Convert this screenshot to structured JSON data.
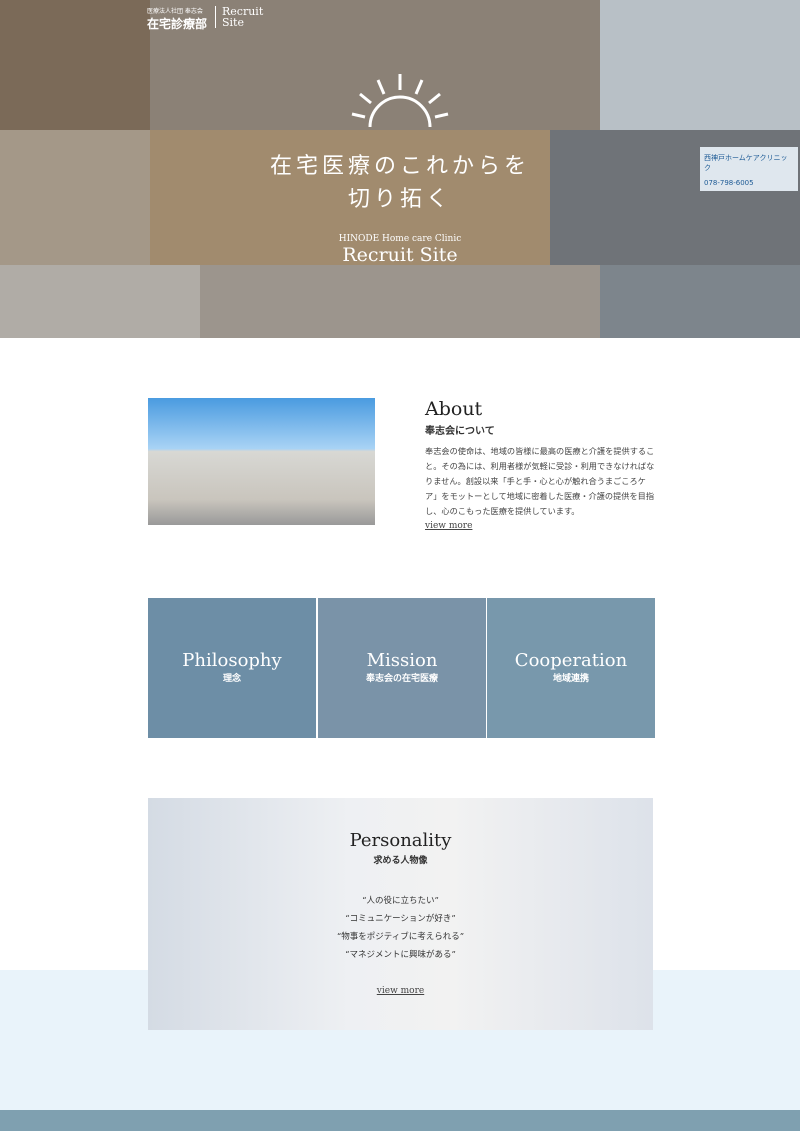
{
  "header": {
    "org": "医療法人社団 奉志会",
    "dept": "在宅診療部",
    "site_label": "Recruit Site"
  },
  "hero": {
    "catch_line1": "在宅医療のこれからを",
    "catch_line2": "切り拓く",
    "clinic": "HINODE Home care Clinic",
    "title": "Recruit Site",
    "sign_text": "西神戸ホームケアクリニック",
    "sign_phone": "078-798-6005"
  },
  "about": {
    "title": "About",
    "subtitle": "奉志会について",
    "text": "奉志会の使命は、地域の皆様に最高の医療と介護を提供すること。その為には、利用者様が気軽に受診・利用できなければなりません。創設以来「手と手・心と心が触れ合うまごころケア」をモットーとして地域に密着した医療・介護の提供を目指し、心のこもった医療を提供しています。",
    "link": "view more"
  },
  "tiles": [
    {
      "title": "Philosophy",
      "sub": "理念"
    },
    {
      "title": "Mission",
      "sub": "奉志会の在宅医療"
    },
    {
      "title": "Cooperation",
      "sub": "地域連携"
    }
  ],
  "personality": {
    "title": "Personality",
    "subtitle": "求める人物像",
    "quotes": [
      "“人の役に立ちたい”",
      "“コミュニケーションが好き”",
      "“物事をポジティブに考えられる”",
      "“マネジメントに興味がある”"
    ],
    "link": "view more"
  }
}
